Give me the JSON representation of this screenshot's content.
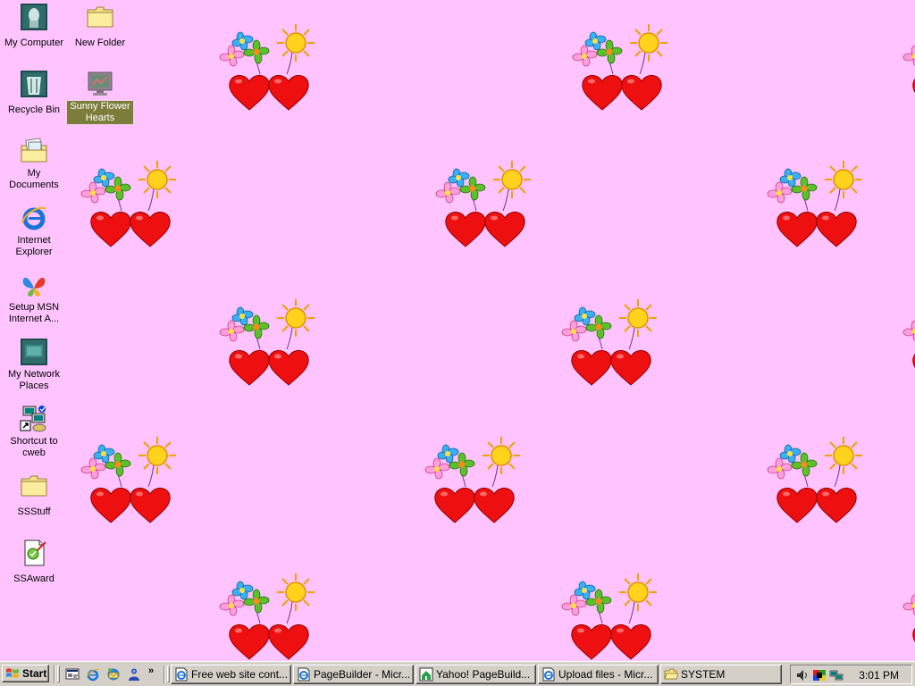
{
  "desktop": {
    "background": "#ffc4ff",
    "icons": [
      {
        "label": "My Computer",
        "icon": "my-computer-icon"
      },
      {
        "label": "New Folder",
        "icon": "folder-icon"
      },
      {
        "label": "Recycle Bin",
        "icon": "recycle-bin-icon"
      },
      {
        "label": "Sunny Flower Hearts",
        "icon": "screensaver-icon",
        "selected": true
      },
      {
        "label": "My Documents",
        "icon": "my-documents-icon"
      },
      {
        "label": "Internet Explorer",
        "icon": "internet-explorer-icon"
      },
      {
        "label": "Setup MSN Internet A...",
        "icon": "msn-butterfly-icon"
      },
      {
        "label": "My Network Places",
        "icon": "network-places-icon"
      },
      {
        "label": "Shortcut to cweb",
        "icon": "shortcut-network-icon"
      },
      {
        "label": "SSStuff",
        "icon": "folder-icon"
      },
      {
        "label": "SSAward",
        "icon": "award-document-icon"
      }
    ],
    "wallpaper": "sunny-flower-hearts-pattern"
  },
  "taskbar": {
    "start_label": "Start",
    "quick_launch": [
      "show-desktop-icon",
      "internet-explorer-icon",
      "outlook-express-icon",
      "msn-messenger-icon"
    ],
    "chevron": "»",
    "tasks": [
      {
        "label": "Free web site cont...",
        "icon": "ie-page-icon"
      },
      {
        "label": "PageBuilder - Micr...",
        "icon": "ie-page-icon"
      },
      {
        "label": "Yahoo! PageBuild...",
        "icon": "yahoo-home-icon"
      },
      {
        "label": "Upload files - Micr...",
        "icon": "ie-page-icon"
      },
      {
        "label": "SYSTEM",
        "icon": "folder-open-icon"
      }
    ],
    "tray_icons": [
      "volume-icon",
      "display-icon",
      "network-icon"
    ],
    "clock": "3:01 PM"
  }
}
